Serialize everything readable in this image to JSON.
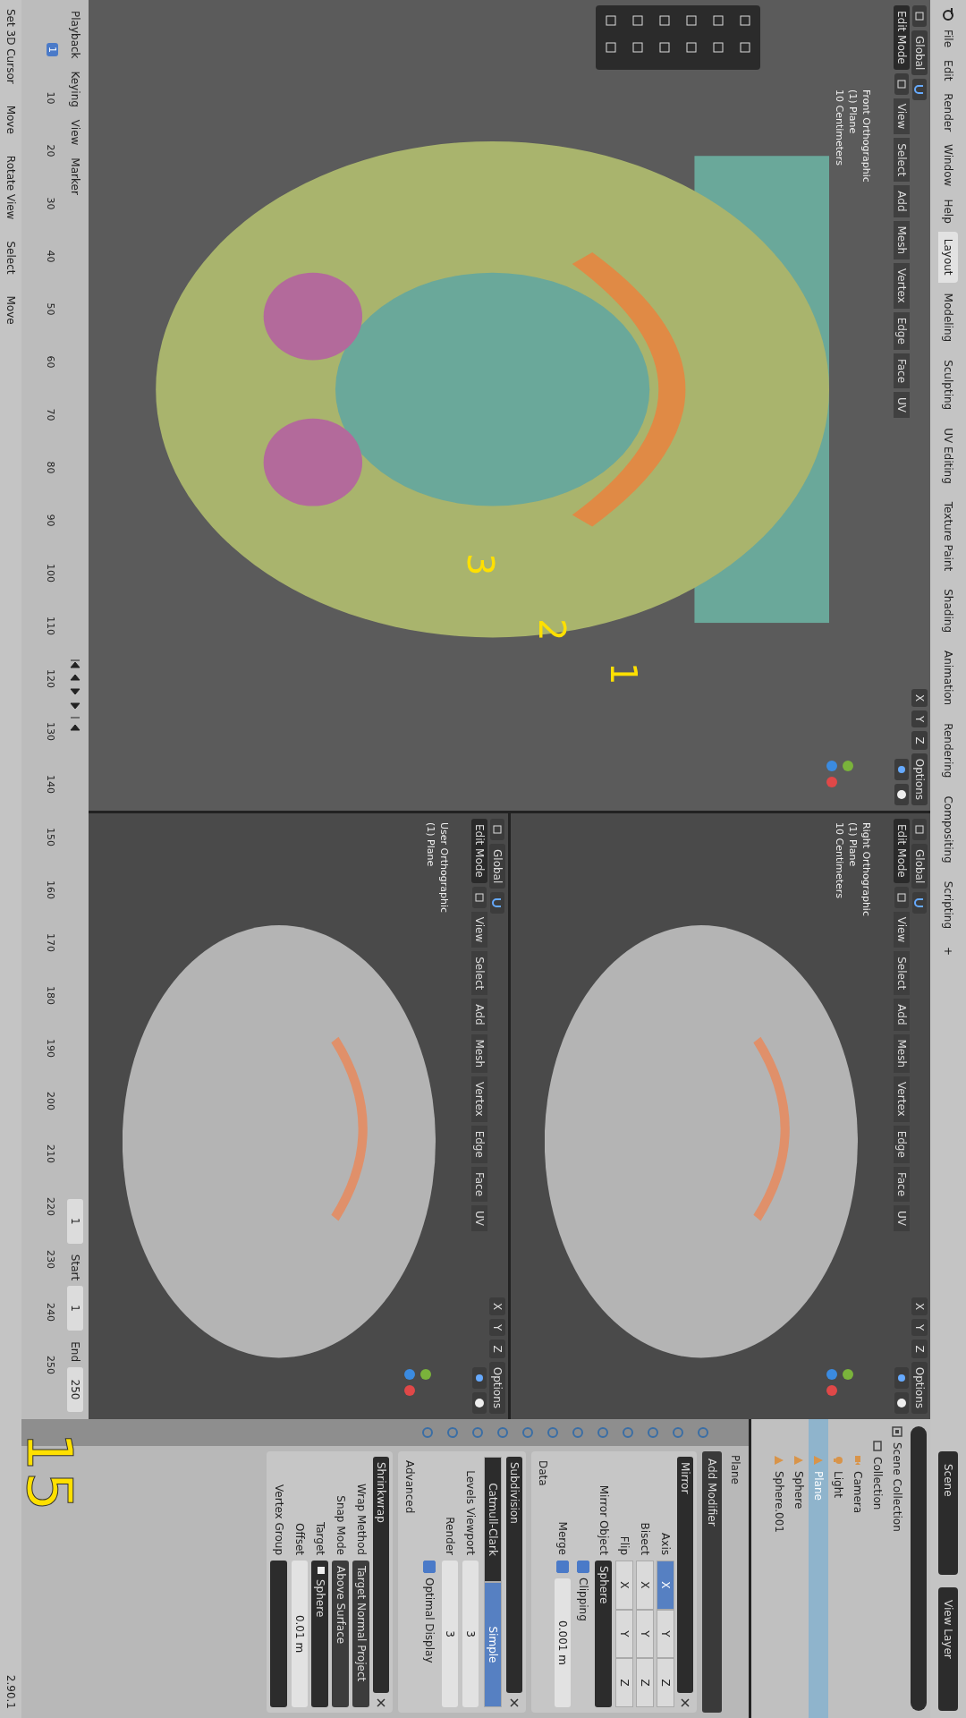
{
  "top_bar": {
    "menus": [
      "File",
      "Edit",
      "Render",
      "Window",
      "Help"
    ],
    "workspaces": [
      {
        "label": "Layout",
        "selected": true
      },
      {
        "label": "Modeling",
        "selected": false
      },
      {
        "label": "Sculpting",
        "selected": false
      },
      {
        "label": "UV Editing",
        "selected": false
      },
      {
        "label": "Texture Paint",
        "selected": false
      },
      {
        "label": "Shading",
        "selected": false
      },
      {
        "label": "Animation",
        "selected": false
      },
      {
        "label": "Rendering",
        "selected": false
      },
      {
        "label": "Compositing",
        "selected": false
      },
      {
        "label": "Scripting",
        "selected": false
      }
    ],
    "add_workspace": "+",
    "scene": "Scene",
    "view_layer": "View Layer"
  },
  "viewports": [
    {
      "header": {
        "mode": "Edit Mode",
        "menus": [
          "View",
          "Select",
          "Add",
          "Mesh",
          "Vertex",
          "Edge",
          "Face",
          "UV"
        ],
        "orientation": "Global",
        "axes": [
          "X",
          "Y",
          "Z"
        ],
        "options": "Options"
      },
      "overlay": [
        "Front Orthographic",
        "(1) Plane",
        "10 Centimeters"
      ],
      "kind": "color",
      "annotations": [
        "1",
        "2",
        "3"
      ]
    },
    {
      "header": {
        "mode": "Edit Mode",
        "menus": [
          "View",
          "Select",
          "Add",
          "Mesh",
          "Vertex",
          "Edge",
          "Face",
          "UV"
        ],
        "orientation": "Global",
        "axes": [
          "X",
          "Y",
          "Z"
        ],
        "options": "Options"
      },
      "overlay": [
        "Right Orthographic",
        "(1) Plane",
        "10 Centimeters"
      ],
      "kind": "gray"
    },
    {
      "header": {
        "mode": "Edit Mode",
        "menus": [
          "View",
          "Select",
          "Add",
          "Mesh",
          "Vertex",
          "Edge",
          "Face",
          "UV"
        ],
        "orientation": "Global",
        "axes": [
          "X",
          "Y",
          "Z"
        ],
        "options": "Options"
      },
      "overlay": [
        "User Orthographic",
        "(1) Plane"
      ],
      "kind": "gray"
    }
  ],
  "timeline": {
    "menus": [
      "Playback",
      "Keying",
      "View",
      "Marker"
    ],
    "current_frame": "1",
    "start_label": "Start",
    "start": "1",
    "end_label": "End",
    "end": "250",
    "ticks": [
      "10",
      "20",
      "30",
      "40",
      "50",
      "60",
      "70",
      "80",
      "90",
      "100",
      "110",
      "120",
      "130",
      "140",
      "150",
      "160",
      "170",
      "180",
      "190",
      "200",
      "210",
      "220",
      "230",
      "240",
      "250"
    ],
    "playhead": "1"
  },
  "outliner": {
    "tree": [
      {
        "name": "Scene Collection",
        "kind": "scene",
        "selected": false,
        "children": [
          {
            "name": "Collection",
            "kind": "collection",
            "selected": false,
            "children": [
              {
                "name": "Camera",
                "kind": "camera",
                "selected": false
              },
              {
                "name": "Light",
                "kind": "light",
                "selected": false
              },
              {
                "name": "Plane",
                "kind": "mesh",
                "selected": true
              },
              {
                "name": "Sphere",
                "kind": "mesh",
                "selected": false
              },
              {
                "name": "Sphere.001",
                "kind": "mesh",
                "selected": false
              }
            ]
          }
        ]
      }
    ]
  },
  "properties": {
    "object": "Plane",
    "add_modifier": "Add Modifier",
    "modifiers": [
      {
        "kind": "mirror",
        "name": "Mirror",
        "rows": [
          {
            "label": "Axis",
            "options": [
              {
                "label": "X",
                "selected": true
              },
              {
                "label": "Y",
                "selected": false
              },
              {
                "label": "Z",
                "selected": false
              }
            ]
          },
          {
            "label": "Bisect",
            "options": [
              {
                "label": "X",
                "selected": false
              },
              {
                "label": "Y",
                "selected": false
              },
              {
                "label": "Z",
                "selected": false
              }
            ]
          },
          {
            "label": "Flip",
            "options": [
              {
                "label": "X",
                "selected": false
              },
              {
                "label": "Y",
                "selected": false
              },
              {
                "label": "Z",
                "selected": false
              }
            ]
          }
        ],
        "mirror_object_label": "Mirror Object",
        "mirror_object": "Sphere",
        "clipping": {
          "label": "Clipping",
          "checked": true
        },
        "merge": {
          "label": "Merge",
          "checked": true,
          "value": "0.001 m"
        },
        "section": "Data"
      },
      {
        "kind": "subdivision",
        "name": "Subdivision",
        "types": [
          {
            "label": "Catmull-Clark",
            "selected": false
          },
          {
            "label": "Simple",
            "selected": true
          }
        ],
        "levels_label": "Levels Viewport",
        "levels": "3",
        "render_label": "Render",
        "render": "3",
        "optimal": {
          "label": "Optimal Display",
          "checked": true
        },
        "section": "Advanced"
      },
      {
        "kind": "shrinkwrap",
        "name": "Shrinkwrap",
        "fields": [
          {
            "label": "Wrap Method",
            "value": "Target Normal Project",
            "kind": "dropdown"
          },
          {
            "label": "Snap Mode",
            "value": "Above Surface",
            "kind": "dropdown"
          },
          {
            "label": "Target",
            "value": "Sphere",
            "kind": "object"
          },
          {
            "label": "Offset",
            "value": "0.01 m",
            "kind": "number"
          },
          {
            "label": "Vertex Group",
            "kind": "group"
          }
        ]
      }
    ]
  },
  "status_bar": {
    "items": [
      "Set 3D Cursor",
      "Move",
      "Rotate View",
      "Select",
      "Move"
    ],
    "version": "2.90.1"
  },
  "annotation": "15"
}
